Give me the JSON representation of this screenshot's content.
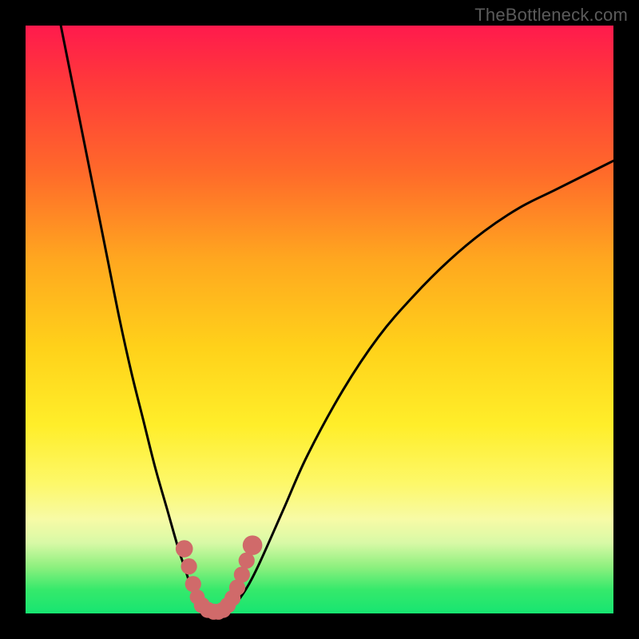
{
  "watermark": "TheBottleneck.com",
  "chart_data": {
    "type": "line",
    "title": "",
    "xlabel": "",
    "ylabel": "",
    "xlim": [
      0,
      100
    ],
    "ylim": [
      0,
      100
    ],
    "grid": false,
    "legend": false,
    "series": [
      {
        "name": "left-branch",
        "x": [
          6,
          8,
          10,
          12,
          14,
          16,
          18,
          20,
          22,
          24,
          26,
          27,
          28,
          29,
          30,
          31
        ],
        "y": [
          100,
          90,
          80,
          70,
          60,
          50,
          41,
          33,
          25,
          18,
          11,
          8,
          5,
          3,
          1,
          0
        ]
      },
      {
        "name": "right-branch",
        "x": [
          34,
          36,
          38,
          40,
          44,
          48,
          54,
          60,
          66,
          72,
          78,
          84,
          90,
          96,
          100
        ],
        "y": [
          0,
          2,
          5,
          9,
          18,
          27,
          38,
          47,
          54,
          60,
          65,
          69,
          72,
          75,
          77
        ]
      }
    ],
    "markers": {
      "name": "bottom-dots",
      "color": "#d06a6a",
      "points": [
        {
          "x": 27.0,
          "y": 11.0,
          "r": 1.2
        },
        {
          "x": 27.8,
          "y": 8.0,
          "r": 1.1
        },
        {
          "x": 28.5,
          "y": 5.0,
          "r": 1.1
        },
        {
          "x": 29.2,
          "y": 2.8,
          "r": 1.0
        },
        {
          "x": 30.0,
          "y": 1.4,
          "r": 1.1
        },
        {
          "x": 31.0,
          "y": 0.6,
          "r": 1.1
        },
        {
          "x": 32.0,
          "y": 0.3,
          "r": 1.1
        },
        {
          "x": 32.8,
          "y": 0.3,
          "r": 1.1
        },
        {
          "x": 33.6,
          "y": 0.6,
          "r": 1.1
        },
        {
          "x": 34.4,
          "y": 1.4,
          "r": 1.1
        },
        {
          "x": 35.2,
          "y": 2.6,
          "r": 1.1
        },
        {
          "x": 36.0,
          "y": 4.4,
          "r": 1.1
        },
        {
          "x": 36.8,
          "y": 6.6,
          "r": 1.1
        },
        {
          "x": 37.6,
          "y": 9.0,
          "r": 1.1
        },
        {
          "x": 38.6,
          "y": 11.6,
          "r": 1.4
        }
      ]
    }
  }
}
